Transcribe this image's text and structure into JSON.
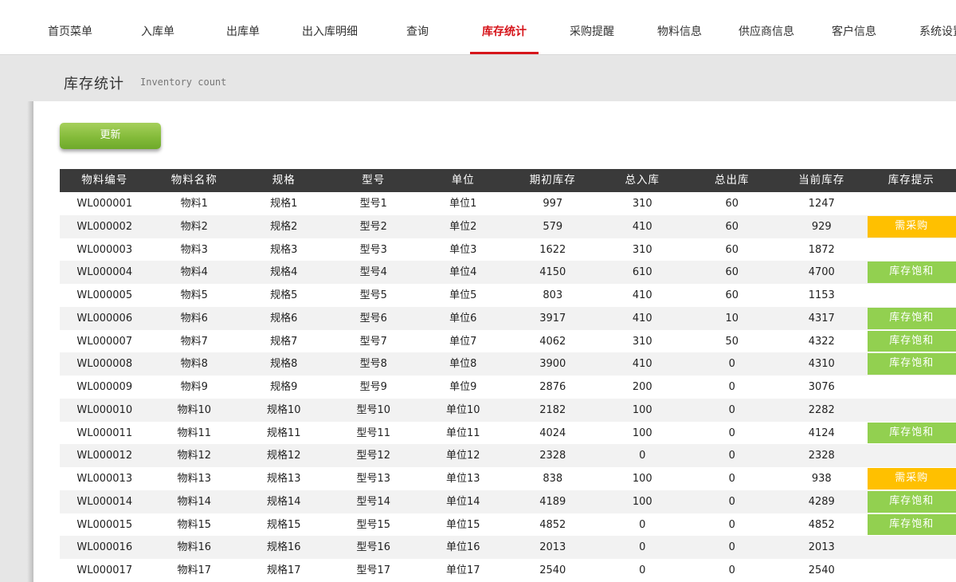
{
  "nav": {
    "items": [
      {
        "label": "首页菜单"
      },
      {
        "label": "入库单"
      },
      {
        "label": "出库单"
      },
      {
        "label": "出入库明细"
      },
      {
        "label": "查询"
      },
      {
        "label": "库存统计"
      },
      {
        "label": "采购提醒"
      },
      {
        "label": "物料信息"
      },
      {
        "label": "供应商信息"
      },
      {
        "label": "客户信息"
      },
      {
        "label": "系统设置"
      }
    ],
    "active_index": 5
  },
  "page": {
    "title": "库存统计",
    "subtitle": "Inventory count"
  },
  "refresh_button": "更新",
  "colors": {
    "active_nav": "#d6151b",
    "header_bg": "#3a3a3a",
    "button_green": "#84bb3a",
    "badge_buy": "#ffc000",
    "badge_full": "#92d050"
  },
  "table": {
    "columns": [
      "物料编号",
      "物料名称",
      "规格",
      "型号",
      "单位",
      "期初库存",
      "总入库",
      "总出库",
      "当前库存",
      "库存提示"
    ],
    "rows": [
      [
        "WL000001",
        "物料1",
        "规格1",
        "型号1",
        "单位1",
        "997",
        "310",
        "60",
        "1247",
        ""
      ],
      [
        "WL000002",
        "物料2",
        "规格2",
        "型号2",
        "单位2",
        "579",
        "410",
        "60",
        "929",
        "需采购"
      ],
      [
        "WL000003",
        "物料3",
        "规格3",
        "型号3",
        "单位3",
        "1622",
        "310",
        "60",
        "1872",
        ""
      ],
      [
        "WL000004",
        "物料4",
        "规格4",
        "型号4",
        "单位4",
        "4150",
        "610",
        "60",
        "4700",
        "库存饱和"
      ],
      [
        "WL000005",
        "物料5",
        "规格5",
        "型号5",
        "单位5",
        "803",
        "410",
        "60",
        "1153",
        ""
      ],
      [
        "WL000006",
        "物料6",
        "规格6",
        "型号6",
        "单位6",
        "3917",
        "410",
        "10",
        "4317",
        "库存饱和"
      ],
      [
        "WL000007",
        "物料7",
        "规格7",
        "型号7",
        "单位7",
        "4062",
        "310",
        "50",
        "4322",
        "库存饱和"
      ],
      [
        "WL000008",
        "物料8",
        "规格8",
        "型号8",
        "单位8",
        "3900",
        "410",
        "0",
        "4310",
        "库存饱和"
      ],
      [
        "WL000009",
        "物料9",
        "规格9",
        "型号9",
        "单位9",
        "2876",
        "200",
        "0",
        "3076",
        ""
      ],
      [
        "WL000010",
        "物料10",
        "规格10",
        "型号10",
        "单位10",
        "2182",
        "100",
        "0",
        "2282",
        ""
      ],
      [
        "WL000011",
        "物料11",
        "规格11",
        "型号11",
        "单位11",
        "4024",
        "100",
        "0",
        "4124",
        "库存饱和"
      ],
      [
        "WL000012",
        "物料12",
        "规格12",
        "型号12",
        "单位12",
        "2328",
        "0",
        "0",
        "2328",
        ""
      ],
      [
        "WL000013",
        "物料13",
        "规格13",
        "型号13",
        "单位13",
        "838",
        "100",
        "0",
        "938",
        "需采购"
      ],
      [
        "WL000014",
        "物料14",
        "规格14",
        "型号14",
        "单位14",
        "4189",
        "100",
        "0",
        "4289",
        "库存饱和"
      ],
      [
        "WL000015",
        "物料15",
        "规格15",
        "型号15",
        "单位15",
        "4852",
        "0",
        "0",
        "4852",
        "库存饱和"
      ],
      [
        "WL000016",
        "物料16",
        "规格16",
        "型号16",
        "单位16",
        "2013",
        "0",
        "0",
        "2013",
        ""
      ],
      [
        "WL000017",
        "物料17",
        "规格17",
        "型号17",
        "单位17",
        "2540",
        "0",
        "0",
        "2540",
        ""
      ]
    ]
  }
}
